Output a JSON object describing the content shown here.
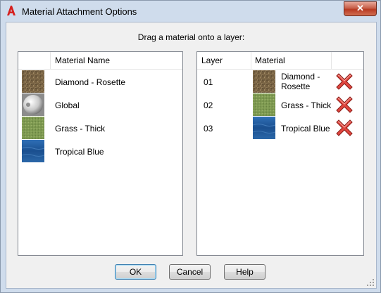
{
  "window": {
    "title": "Material Attachment Options",
    "close_label": "✕"
  },
  "instruction": "Drag a material onto a layer:",
  "materials_list": {
    "column_header": "Material Name",
    "items": [
      {
        "name": "Diamond - Rosette",
        "thumbnail": "diamond-rosette-texture"
      },
      {
        "name": "Global",
        "thumbnail": "global-sphere"
      },
      {
        "name": "Grass - Thick",
        "thumbnail": "grass-thick-texture"
      },
      {
        "name": "Tropical Blue",
        "thumbnail": "tropical-blue-texture"
      }
    ]
  },
  "layers_list": {
    "columns": [
      "Layer",
      "Material"
    ],
    "rows": [
      {
        "layer": "01",
        "material_line1": "Diamond -",
        "material_line2": "Rosette",
        "thumbnail": "diamond-rosette-texture",
        "remove_icon": "red-x-icon"
      },
      {
        "layer": "02",
        "material_line1": "Grass - Thick",
        "material_line2": "",
        "thumbnail": "grass-thick-texture",
        "remove_icon": "red-x-icon"
      },
      {
        "layer": "03",
        "material_line1": "Tropical Blue",
        "material_line2": "",
        "thumbnail": "tropical-blue-texture",
        "remove_icon": "red-x-icon"
      }
    ]
  },
  "buttons": {
    "ok": "OK",
    "cancel": "Cancel",
    "help": "Help"
  },
  "colors": {
    "accent_red": "#d9302c",
    "grass": "#7e9a4f",
    "water": "#1f5aa0",
    "stone": "#7a6446"
  }
}
